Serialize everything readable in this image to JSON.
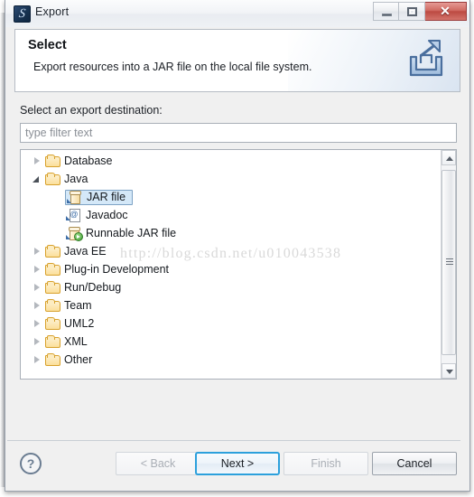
{
  "window": {
    "title": "Export",
    "app_icon": "eclipse-icon",
    "controls": {
      "minimize": "minimize-icon",
      "maximize": "restore-icon",
      "close": "✕"
    }
  },
  "header": {
    "title": "Select",
    "description": "Export resources into a JAR file on the local file system.",
    "banner_icon": "export-arrow-icon"
  },
  "body": {
    "destination_label": "Select an export destination:",
    "filter": {
      "value": "",
      "placeholder": "type filter text"
    },
    "tree": [
      {
        "label": "Database",
        "icon": "folder-icon",
        "state": "collapsed",
        "indent": 0,
        "selected": false
      },
      {
        "label": "Java",
        "icon": "folder-icon",
        "state": "expanded",
        "indent": 0,
        "selected": false
      },
      {
        "label": "JAR file",
        "icon": "jar-icon",
        "state": "leaf",
        "indent": 1,
        "selected": true
      },
      {
        "label": "Javadoc",
        "icon": "javadoc-icon",
        "state": "leaf",
        "indent": 1,
        "selected": false
      },
      {
        "label": "Runnable JAR file",
        "icon": "runnable-jar-icon",
        "state": "leaf",
        "indent": 1,
        "selected": false
      },
      {
        "label": "Java EE",
        "icon": "folder-icon",
        "state": "collapsed",
        "indent": 0,
        "selected": false
      },
      {
        "label": "Plug-in Development",
        "icon": "folder-icon",
        "state": "collapsed",
        "indent": 0,
        "selected": false
      },
      {
        "label": "Run/Debug",
        "icon": "folder-icon",
        "state": "collapsed",
        "indent": 0,
        "selected": false
      },
      {
        "label": "Team",
        "icon": "folder-icon",
        "state": "collapsed",
        "indent": 0,
        "selected": false
      },
      {
        "label": "UML2",
        "icon": "folder-icon",
        "state": "collapsed",
        "indent": 0,
        "selected": false
      },
      {
        "label": "XML",
        "icon": "folder-icon",
        "state": "collapsed",
        "indent": 0,
        "selected": false
      },
      {
        "label": "Other",
        "icon": "folder-icon",
        "state": "collapsed",
        "indent": 0,
        "selected": false
      }
    ],
    "scrollbar": {
      "up_arrow": "scroll-up-icon",
      "down_arrow": "scroll-down-icon"
    }
  },
  "footer": {
    "help_label": "?",
    "buttons": [
      {
        "label": "< Back",
        "name": "back-button",
        "state": "disabled"
      },
      {
        "label": "Next >",
        "name": "next-button",
        "state": "default"
      },
      {
        "label": "Finish",
        "name": "finish-button",
        "state": "disabled"
      },
      {
        "label": "Cancel",
        "name": "cancel-button",
        "state": "enabled"
      }
    ]
  },
  "watermark": "http://blog.csdn.net/u010043538",
  "colors": {
    "accent_blue": "#2ca0dc",
    "selection_fill": "#d4e8f8",
    "selection_border": "#7da2c4",
    "close_red": "#bc4a42",
    "folder_yellow": "#fbdf9b",
    "dialog_bg": "#f0f0f0"
  }
}
